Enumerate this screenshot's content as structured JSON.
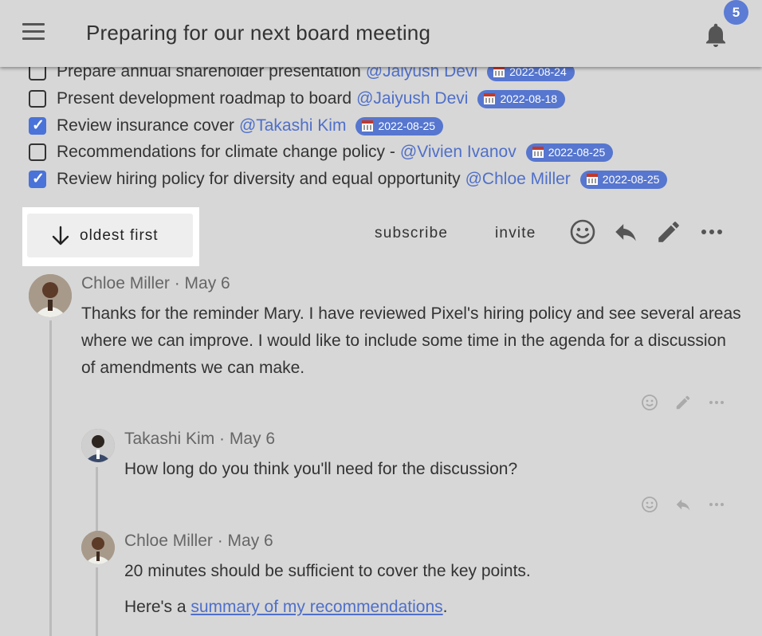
{
  "header": {
    "title": "Preparing for our next board meeting",
    "notification_count": "5"
  },
  "tasks": [
    {
      "text": "Prepare annual shareholder presentation",
      "mention": "@Jaiyush Devi",
      "date": "2022-08-24",
      "checked": false
    },
    {
      "text": "Present development roadmap to board",
      "mention": "@Jaiyush Devi",
      "date": "2022-08-18",
      "checked": false
    },
    {
      "text": "Review insurance cover",
      "mention": "@Takashi Kim",
      "date": "2022-08-25",
      "checked": true
    },
    {
      "text": "Recommendations for climate change policy -",
      "mention": "@Vivien Ivanov",
      "date": "2022-08-25",
      "checked": false
    },
    {
      "text": "Review hiring policy for diversity and equal opportunity",
      "mention": "@Chloe Miller",
      "date": "2022-08-25",
      "checked": true
    }
  ],
  "toolbar": {
    "sort_label": "oldest first",
    "subscribe_label": "subscribe",
    "invite_label": "invite"
  },
  "comments": [
    {
      "author": "Chloe Miller · May 6",
      "body": "Thanks for the reminder Mary. I have reviewed Pixel's hiring policy and see several areas where we can improve. I would like to include some time in the agenda for a discussion of amendments we can make."
    },
    {
      "author": "Takashi Kim · May 6",
      "body": "How long do you think you'll need for the discussion?"
    },
    {
      "author": "Chloe Miller · May 6",
      "body": "20 minutes should be sufficient to cover the key points.",
      "body2_prefix": "Here's a ",
      "body2_link": "summary of my recommendations",
      "body2_suffix": "."
    }
  ],
  "colors": {
    "accent": "#5676cf",
    "mention": "#4f6fc9",
    "background": "#d7d7d7"
  }
}
